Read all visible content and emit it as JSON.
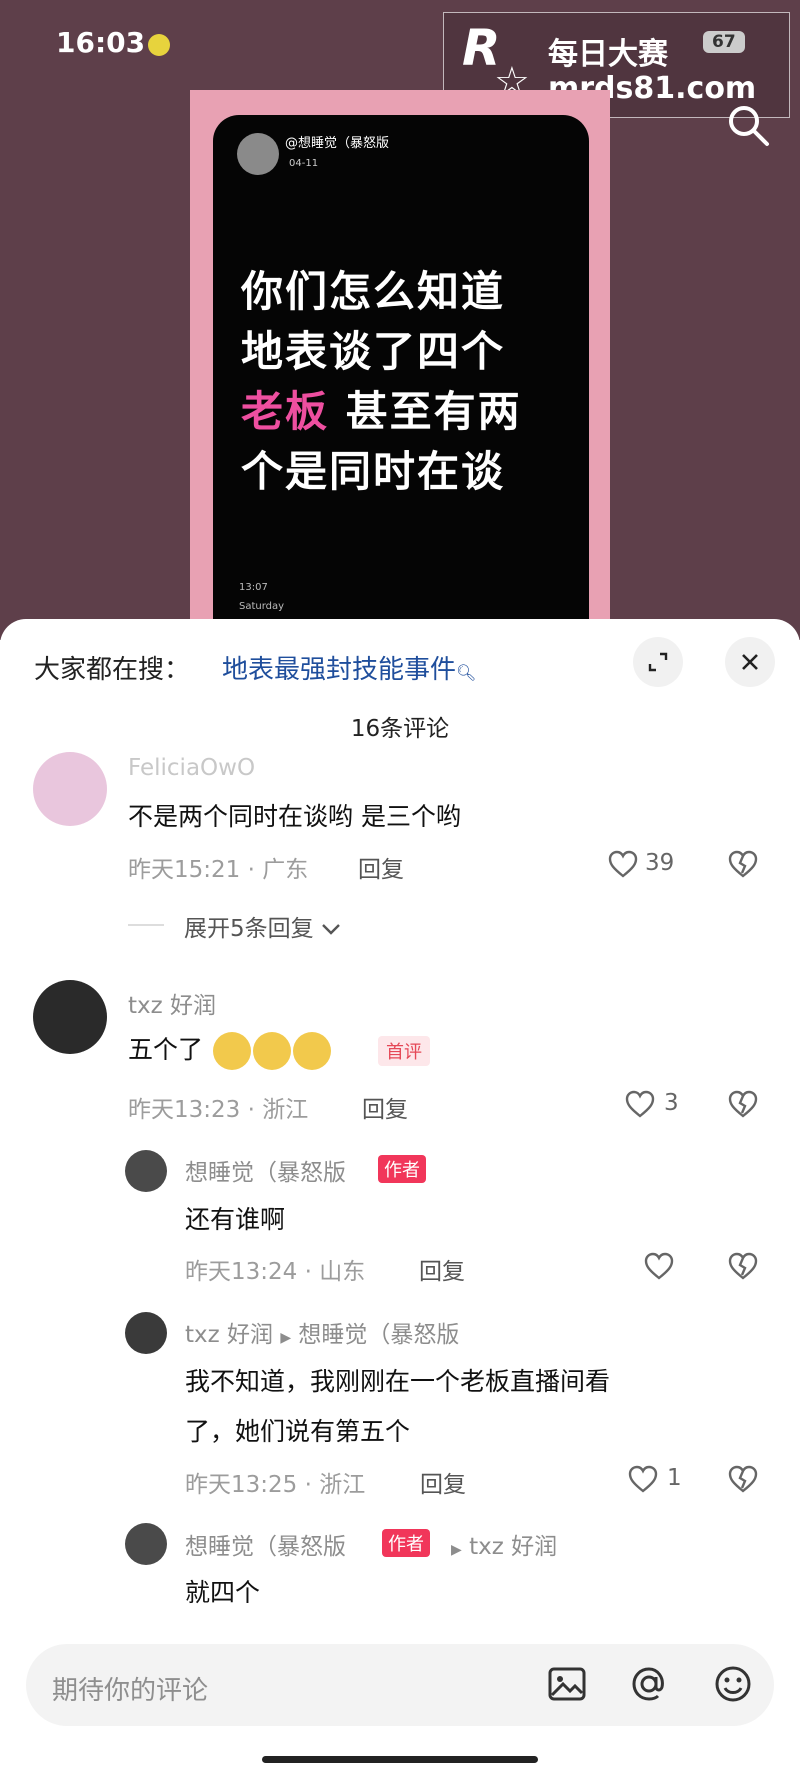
{
  "status_bar": {
    "time": "16:03",
    "battery": "67"
  },
  "watermark": {
    "logo_letter": "R",
    "line1": "每日大赛",
    "line2": "mrds81.com"
  },
  "post_card": {
    "username": "@想睡觉（暴怒版",
    "date": "04-11",
    "lines": [
      "你们怎么知道",
      "地表谈了四个"
    ],
    "line3_highlight": "老板",
    "line3_rest": "甚至有两",
    "line4": "个是同时在谈",
    "time": "13:07",
    "day": "Saturday"
  },
  "sheet": {
    "search_label": "大家都在搜：",
    "search_term": "地表最强封技能事件",
    "comment_count": "16条评论"
  },
  "comments": [
    {
      "user": "FeliciaOwO",
      "text": "不是两个同时在谈哟 是三个哟",
      "time": "昨天15:21 · 广东",
      "reply": "回复",
      "likes": "39"
    },
    {
      "user": "txz 好润",
      "text": "五个了",
      "badge": "首评",
      "time": "昨天13:23 · 浙江",
      "reply": "回复",
      "likes": "3"
    }
  ],
  "expand": "展开5条回复",
  "replies": [
    {
      "user": "想睡觉（暴怒版",
      "badge": "作者",
      "text": "还有谁啊",
      "time": "昨天13:24 · 山东",
      "reply": "回复",
      "likes": ""
    },
    {
      "user": "txz 好润",
      "to": "想睡觉（暴怒版",
      "text1": "我不知道，我刚刚在一个老板直播间看",
      "text2": "了，她们说有第五个",
      "time": "昨天13:25 · 浙江",
      "reply": "回复",
      "likes": "1"
    },
    {
      "user": "想睡觉（暴怒版",
      "badge": "作者",
      "to": "txz 好润",
      "text": "就四个"
    }
  ],
  "input": {
    "placeholder": "期待你的评论"
  },
  "icons": [
    "search-icon",
    "expand-icon",
    "close-icon",
    "heart-icon",
    "broken-heart-icon",
    "image-icon",
    "at-icon",
    "emoji-icon",
    "chevron-down-icon"
  ]
}
